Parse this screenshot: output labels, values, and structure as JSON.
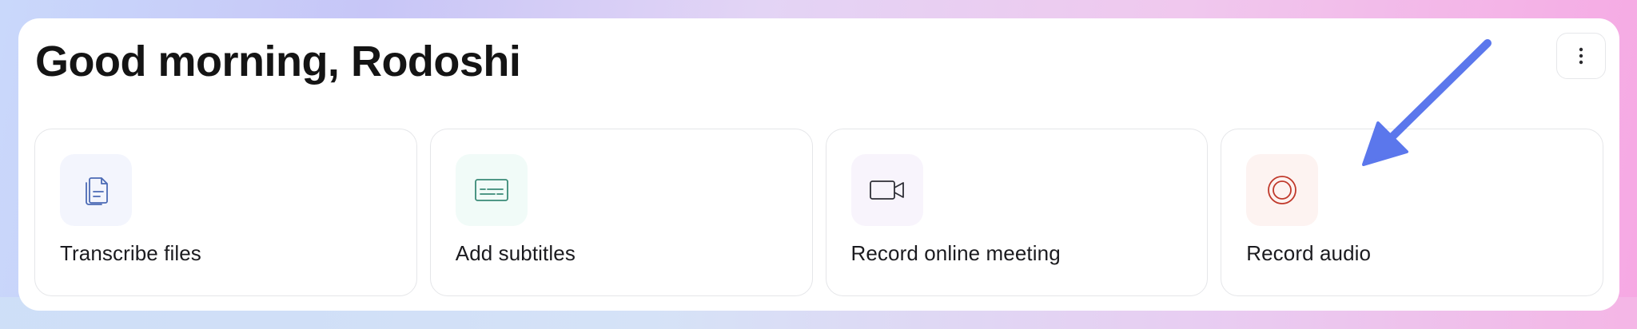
{
  "greeting": "Good morning, Rodoshi",
  "menu": {
    "icon": "more-vertical-icon"
  },
  "cards": [
    {
      "label": "Transcribe files",
      "icon": "document-copy-icon",
      "icon_color": "#4b6ab5",
      "icon_bg": "#f3f5fd"
    },
    {
      "label": "Add subtitles",
      "icon": "subtitles-icon",
      "icon_color": "#3a8a77",
      "icon_bg": "#f1fbf8"
    },
    {
      "label": "Record online meeting",
      "icon": "video-camera-icon",
      "icon_color": "#2e2e36",
      "icon_bg": "#f8f4fc"
    },
    {
      "label": "Record audio",
      "icon": "record-icon",
      "icon_color": "#c0392b",
      "icon_bg": "#fdf3f1"
    }
  ],
  "annotation": {
    "icon": "pointer-arrow-icon",
    "color": "#5b77ec"
  }
}
